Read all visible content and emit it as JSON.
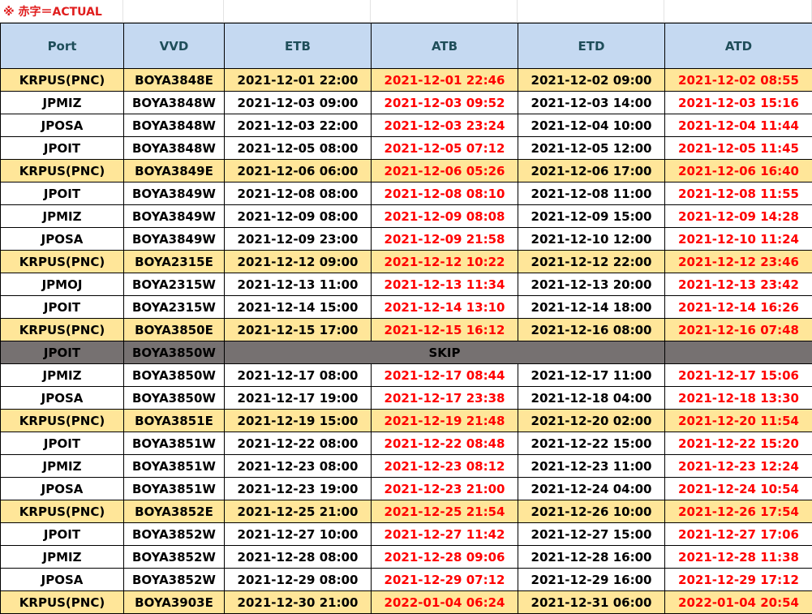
{
  "note": "※ 赤字＝ACTUAL",
  "headers": [
    "Port",
    "VVD",
    "ETB",
    "ATB",
    "ETD",
    "ATD"
  ],
  "rows": [
    {
      "port": "KRPUS(PNC)",
      "vvd": "BOYA3848E",
      "etb": "2021-12-01 22:00",
      "atb": "2021-12-01 22:46",
      "etd": "2021-12-02 09:00",
      "atd": "2021-12-02 08:55"
    },
    {
      "port": "JPMIZ",
      "vvd": "BOYA3848W",
      "etb": "2021-12-03 09:00",
      "atb": "2021-12-03 09:52",
      "etd": "2021-12-03 14:00",
      "atd": "2021-12-03 15:16"
    },
    {
      "port": "JPOSA",
      "vvd": "BOYA3848W",
      "etb": "2021-12-03 22:00",
      "atb": "2021-12-03 23:24",
      "etd": "2021-12-04 10:00",
      "atd": "2021-12-04 11:44"
    },
    {
      "port": "JPOIT",
      "vvd": "BOYA3848W",
      "etb": "2021-12-05 08:00",
      "atb": "2021-12-05 07:12",
      "etd": "2021-12-05 12:00",
      "atd": "2021-12-05 11:45"
    },
    {
      "port": "KRPUS(PNC)",
      "vvd": "BOYA3849E",
      "etb": "2021-12-06 06:00",
      "atb": "2021-12-06 05:26",
      "etd": "2021-12-06 17:00",
      "atd": "2021-12-06 16:40"
    },
    {
      "port": "JPOIT",
      "vvd": "BOYA3849W",
      "etb": "2021-12-08 08:00",
      "atb": "2021-12-08 08:10",
      "etd": "2021-12-08 11:00",
      "atd": "2021-12-08 11:55"
    },
    {
      "port": "JPMIZ",
      "vvd": "BOYA3849W",
      "etb": "2021-12-09 08:00",
      "atb": "2021-12-09 08:08",
      "etd": "2021-12-09 15:00",
      "atd": "2021-12-09 14:28"
    },
    {
      "port": "JPOSA",
      "vvd": "BOYA3849W",
      "etb": "2021-12-09 23:00",
      "atb": "2021-12-09 21:58",
      "etd": "2021-12-10 12:00",
      "atd": "2021-12-10 11:24"
    },
    {
      "port": "KRPUS(PNC)",
      "vvd": "BOYA2315E",
      "etb": "2021-12-12 09:00",
      "atb": "2021-12-12 10:22",
      "etd": "2021-12-12 22:00",
      "atd": "2021-12-12 23:46"
    },
    {
      "port": "JPMOJ",
      "vvd": "BOYA2315W",
      "etb": "2021-12-13 11:00",
      "atb": "2021-12-13 11:34",
      "etd": "2021-12-13 20:00",
      "atd": "2021-12-13 23:42"
    },
    {
      "port": "JPOIT",
      "vvd": "BOYA2315W",
      "etb": "2021-12-14 15:00",
      "atb": "2021-12-14 13:10",
      "etd": "2021-12-14 18:00",
      "atd": "2021-12-14 16:26"
    },
    {
      "port": "KRPUS(PNC)",
      "vvd": "BOYA3850E",
      "etb": "2021-12-15 17:00",
      "atb": "2021-12-15 16:12",
      "etd": "2021-12-16 08:00",
      "atd": "2021-12-16 07:48"
    },
    {
      "port": "JPOIT",
      "vvd": "BOYA3850W",
      "skip": "SKIP"
    },
    {
      "port": "JPMIZ",
      "vvd": "BOYA3850W",
      "etb": "2021-12-17 08:00",
      "atb": "2021-12-17 08:44",
      "etd": "2021-12-17 11:00",
      "atd": "2021-12-17 15:06"
    },
    {
      "port": "JPOSA",
      "vvd": "BOYA3850W",
      "etb": "2021-12-17 19:00",
      "atb": "2021-12-17 23:38",
      "etd": "2021-12-18 04:00",
      "atd": "2021-12-18 13:30"
    },
    {
      "port": "KRPUS(PNC)",
      "vvd": "BOYA3851E",
      "etb": "2021-12-19 15:00",
      "atb": "2021-12-19 21:48",
      "etd": "2021-12-20 02:00",
      "atd": "2021-12-20 11:54"
    },
    {
      "port": "JPOIT",
      "vvd": "BOYA3851W",
      "etb": "2021-12-22 08:00",
      "atb": "2021-12-22 08:48",
      "etd": "2021-12-22 15:00",
      "atd": "2021-12-22 15:20"
    },
    {
      "port": "JPMIZ",
      "vvd": "BOYA3851W",
      "etb": "2021-12-23 08:00",
      "atb": "2021-12-23 08:12",
      "etd": "2021-12-23 11:00",
      "atd": "2021-12-23 12:24"
    },
    {
      "port": "JPOSA",
      "vvd": "BOYA3851W",
      "etb": "2021-12-23 19:00",
      "atb": "2021-12-23 21:00",
      "etd": "2021-12-24 04:00",
      "atd": "2021-12-24 10:54"
    },
    {
      "port": "KRPUS(PNC)",
      "vvd": "BOYA3852E",
      "etb": "2021-12-25 21:00",
      "atb": "2021-12-25 21:54",
      "etd": "2021-12-26 10:00",
      "atd": "2021-12-26 17:54"
    },
    {
      "port": "JPOIT",
      "vvd": "BOYA3852W",
      "etb": "2021-12-27 10:00",
      "atb": "2021-12-27 11:42",
      "etd": "2021-12-27 15:00",
      "atd": "2021-12-27 17:06"
    },
    {
      "port": "JPMIZ",
      "vvd": "BOYA3852W",
      "etb": "2021-12-28 08:00",
      "atb": "2021-12-28 09:06",
      "etd": "2021-12-28 16:00",
      "atd": "2021-12-28 11:38"
    },
    {
      "port": "JPOSA",
      "vvd": "BOYA3852W",
      "etb": "2021-12-29 08:00",
      "atb": "2021-12-29 07:12",
      "etd": "2021-12-29 16:00",
      "atd": "2021-12-29 17:12"
    },
    {
      "port": "KRPUS(PNC)",
      "vvd": "BOYA3903E",
      "etb": "2021-12-30 21:00",
      "atb": "2022-01-04 06:24",
      "etd": "2021-12-31 06:00",
      "atd": "2022-01-04 20:54"
    }
  ]
}
